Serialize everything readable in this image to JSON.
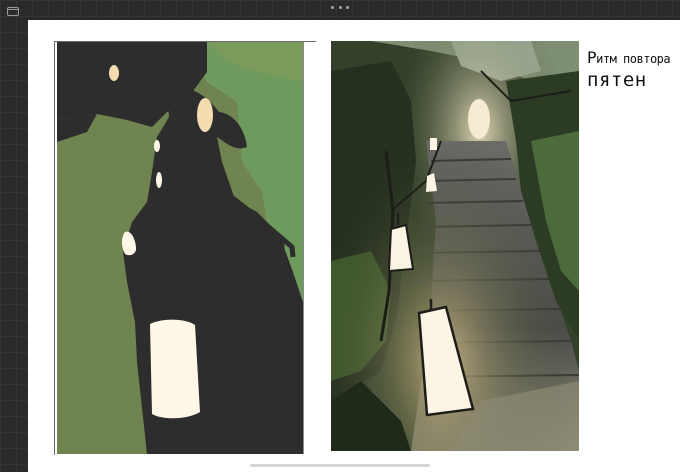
{
  "toolbar": {
    "icons": [
      "sidebar-toggle-icon",
      "more-options-icon"
    ]
  },
  "canvas": {
    "note": {
      "line1_big": "Р",
      "line1_rest": "итм повтора",
      "line2": "пятен"
    }
  },
  "colors": {
    "workspace": "#2a2a2a",
    "page": "#ffffff",
    "study_green": "#6f8450",
    "study_sage": "#6f9a5e",
    "study_dark": "#2d2d2d",
    "study_light": "#fff7e8",
    "study_warm": "#f4dbb0",
    "painting_shadow": "#22261c",
    "lantern_glow": "#fdf5e3"
  }
}
